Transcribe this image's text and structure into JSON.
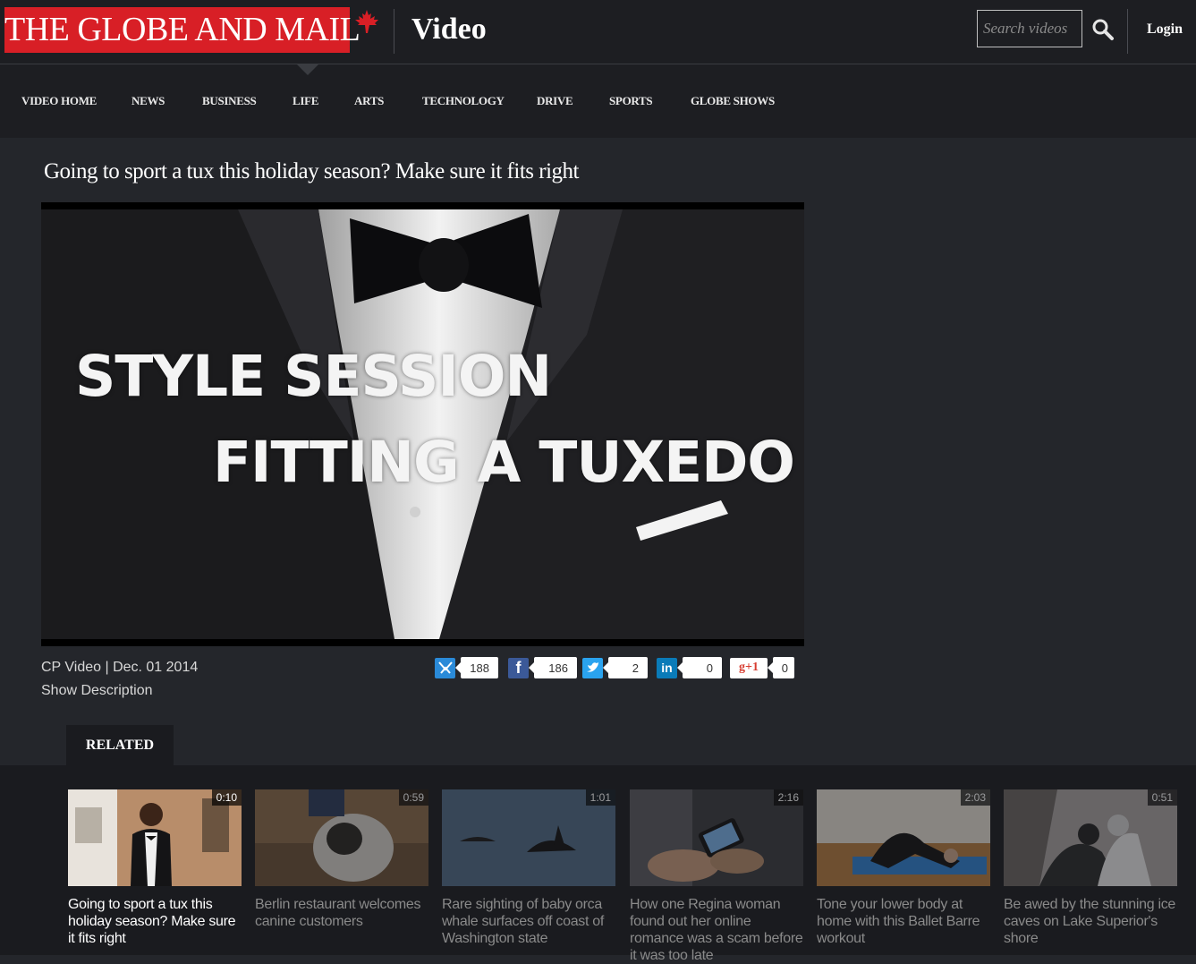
{
  "header": {
    "logo": "THE GLOBE AND MAIL",
    "section": "Video",
    "search_placeholder": "Search videos",
    "login": "Login"
  },
  "nav": [
    "VIDEO HOME",
    "NEWS",
    "BUSINESS",
    "LIFE",
    "ARTS",
    "TECHNOLOGY",
    "DRIVE",
    "SPORTS",
    "GLOBE SHOWS"
  ],
  "video": {
    "headline": "Going to sport a tux this holiday season? Make sure it fits right",
    "overlay_line1": "STYLE SESSION",
    "overlay_line2": "FITTING A TUXEDO",
    "meta": "CP Video | Dec. 01 2014",
    "show_description": "Show Description"
  },
  "share": [
    {
      "network": "share-icon",
      "count": "188",
      "color": "#2a8ad8"
    },
    {
      "network": "facebook-icon",
      "count": "186",
      "color": "#3b5998"
    },
    {
      "network": "twitter-icon",
      "count": "2",
      "color": "#2aa3ef"
    },
    {
      "network": "linkedin-icon",
      "count": "0",
      "color": "#0a7bb8"
    },
    {
      "network": "google-plus-icon",
      "label": "g+1",
      "count": "0",
      "color": "#ffffff"
    }
  ],
  "related": {
    "tab": "RELATED",
    "items": [
      {
        "title": "Going to sport a tux this holiday season? Make sure it fits right",
        "duration": "0:10"
      },
      {
        "title": "Berlin restaurant welcomes canine customers",
        "duration": "0:59"
      },
      {
        "title": "Rare sighting of baby orca whale surfaces off coast of Washington state",
        "duration": "1:01"
      },
      {
        "title": "How one Regina woman found out her online romance was a scam before it was too late",
        "duration": "2:16"
      },
      {
        "title": "Tone your lower body at home with this Ballet Barre workout",
        "duration": "2:03"
      },
      {
        "title": "Be awed by the stunning ice caves on Lake Superior's shore",
        "duration": "0:51"
      }
    ]
  }
}
